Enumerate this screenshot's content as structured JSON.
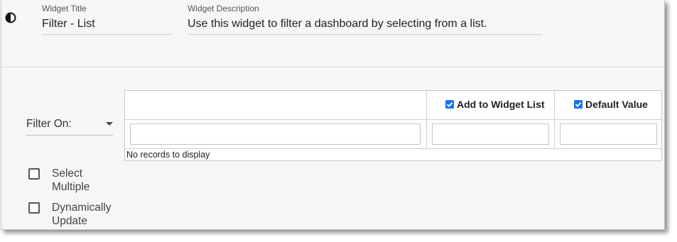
{
  "widget": {
    "title_label": "Widget Title",
    "title_value": "Filter - List",
    "description_label": "Widget Description",
    "description_value": "Use this widget to filter a dashboard by selecting from a list."
  },
  "filter": {
    "label": "Filter On:"
  },
  "table": {
    "columns": [
      {
        "label": "",
        "checked": false
      },
      {
        "label": "Add to Widget List",
        "checked": true
      },
      {
        "label": "Default Value",
        "checked": true
      }
    ],
    "empty_message": "No records to display"
  },
  "options": [
    {
      "label_line1": "Select",
      "label_line2": "Multiple",
      "checked": false
    },
    {
      "label_line1": "Dynamically",
      "label_line2": "Update",
      "checked": false
    }
  ],
  "colors": {
    "accent": "#1a73e8",
    "panel_background": "#f6f6f6"
  }
}
